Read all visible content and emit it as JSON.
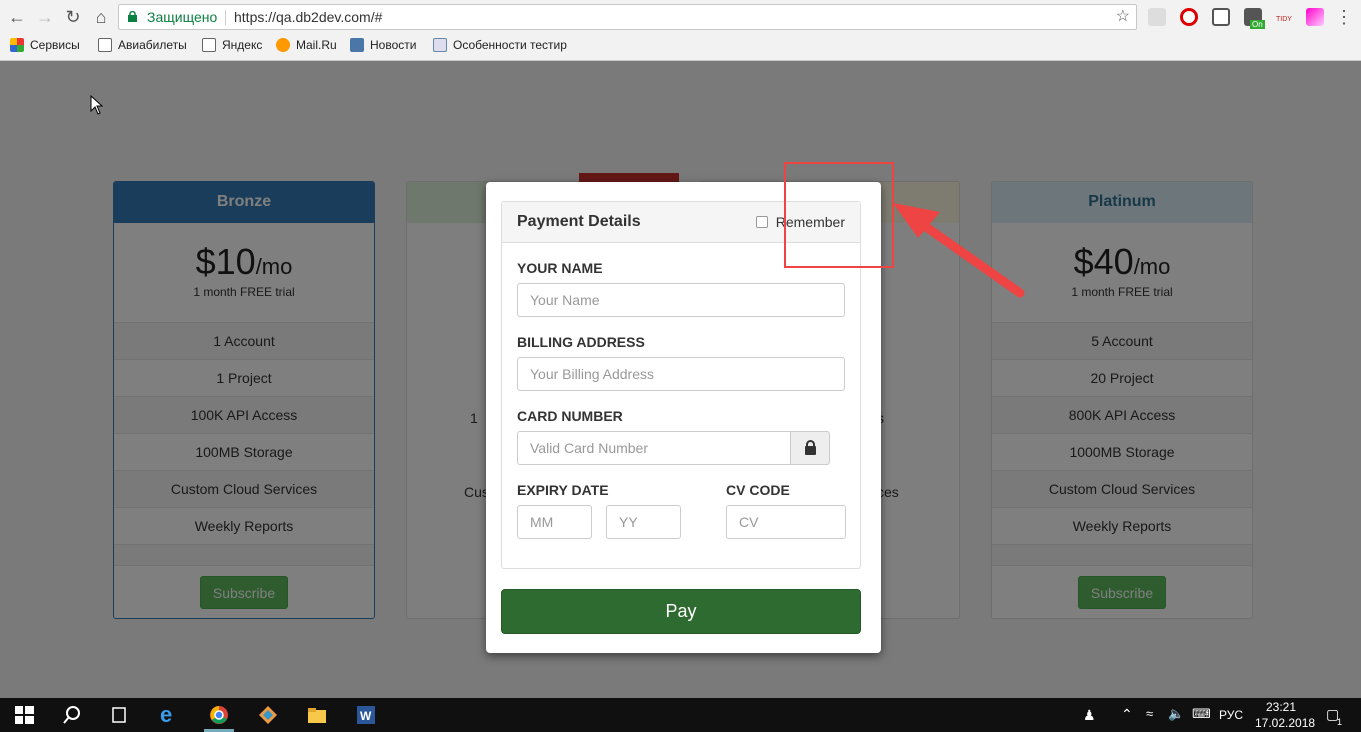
{
  "browser": {
    "secure_label": "Защищено",
    "url": "https://qa.db2dev.com/#",
    "bookmarks": [
      "Сервисы",
      "Авиабилеты",
      "Яндекс",
      "Mail.Ru",
      "Новости",
      "Особенности тестир"
    ],
    "ext_badge": "On",
    "ext_tidy": "TIDY"
  },
  "plans": [
    {
      "name": "Bronze",
      "price": "$10",
      "period": "/mo",
      "trial": "1 month FREE trial",
      "features": [
        "1 Account",
        "1 Project",
        "100K API Access",
        "100MB Storage",
        "Custom Cloud Services",
        "Weekly Reports"
      ],
      "button": "Subscribe"
    },
    {
      "name": "Platinum",
      "price": "$40",
      "period": "/mo",
      "trial": "1 month FREE trial",
      "features": [
        "5 Account",
        "20 Project",
        "800K API Access",
        "1000MB Storage",
        "Custom Cloud Services",
        "Weekly Reports"
      ],
      "button": "Subscribe"
    }
  ],
  "hidden_fragments": {
    "silver_api": "1",
    "silver_custom": "Cus",
    "gold_api": "s",
    "gold_custom": "ces"
  },
  "modal": {
    "title": "Payment Details",
    "remember": "Remember",
    "name_label": "YOUR NAME",
    "name_placeholder": "Your Name",
    "address_label": "BILLING ADDRESS",
    "address_placeholder": "Your Billing Address",
    "card_label": "CARD NUMBER",
    "card_placeholder": "Valid Card Number",
    "expiry_label": "EXPIRY DATE",
    "mm_placeholder": "MM",
    "yy_placeholder": "YY",
    "cv_label": "CV CODE",
    "cv_placeholder": "CV",
    "pay": "Pay"
  },
  "taskbar": {
    "lang": "РУС",
    "time": "23:21",
    "date": "17.02.2018",
    "notif": "1"
  },
  "colors": {
    "bronze_header": "#337ab7",
    "platinum_header": "#d9edf7",
    "pay_button": "#2e6b30",
    "annotation": "#ee4444"
  }
}
